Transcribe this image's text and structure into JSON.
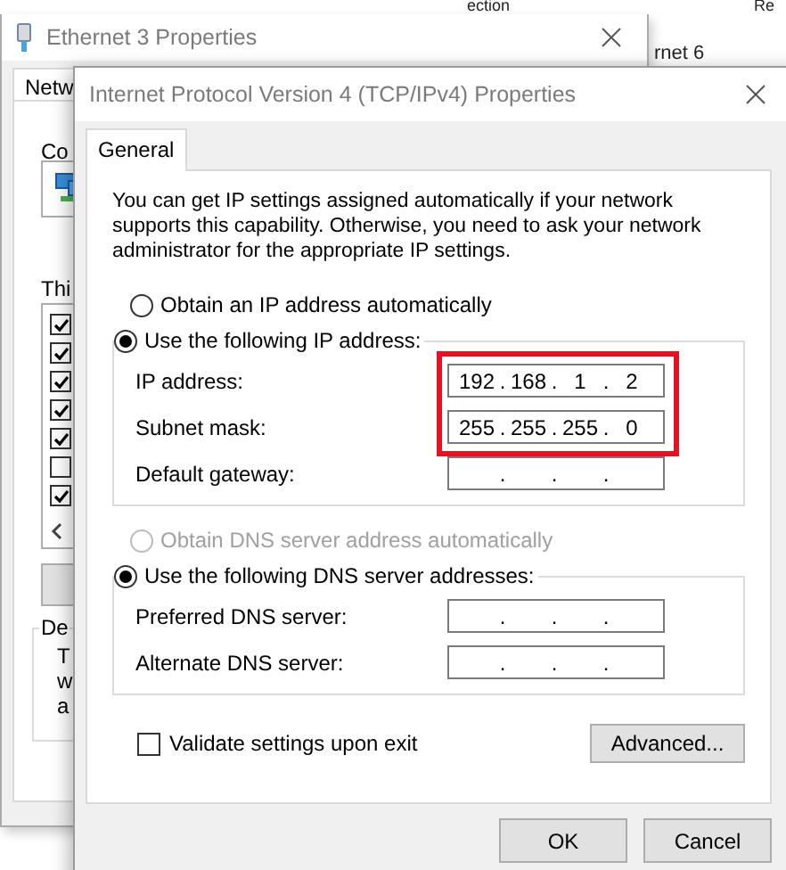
{
  "back_window": {
    "column_headers": [
      "ection",
      "Re"
    ],
    "item": "rnet 6"
  },
  "ethernet_dialog": {
    "title": "Ethernet 3 Properties",
    "tab": "Netw",
    "connect_label": "Co",
    "list_label": "Thi",
    "components": [
      {
        "checked": true
      },
      {
        "checked": true
      },
      {
        "checked": true
      },
      {
        "checked": true
      },
      {
        "checked": true
      },
      {
        "checked": false
      },
      {
        "checked": true
      }
    ],
    "description_group": "De",
    "description_lines": [
      "T",
      "w",
      "a"
    ]
  },
  "ipv4_dialog": {
    "title": "Internet Protocol Version 4 (TCP/IPv4) Properties",
    "tabs": [
      {
        "label": "General",
        "selected": true
      }
    ],
    "intro": "You can get IP settings assigned automatically if your network supports this capability. Otherwise, you need to ask your network administrator for the appropriate IP settings.",
    "separator": ".",
    "ip_auto": {
      "label": "Obtain an IP address automatically",
      "selected": false,
      "disabled": false
    },
    "ip_manual": {
      "label": "Use the following IP address:",
      "selected": true,
      "disabled": false
    },
    "ip_fields": [
      {
        "label": "IP address:",
        "octets": [
          "192",
          "168",
          "1",
          "2"
        ],
        "highlighted": true
      },
      {
        "label": "Subnet mask:",
        "octets": [
          "255",
          "255",
          "255",
          "0"
        ],
        "highlighted": true
      },
      {
        "label": "Default gateway:",
        "highlighted": false
      }
    ],
    "dns_auto": {
      "label": "Obtain DNS server address automatically",
      "selected": false,
      "disabled": true
    },
    "dns_manual": {
      "label": "Use the following DNS server addresses:",
      "selected": true,
      "disabled": false
    },
    "dns_fields": [
      {
        "label": "Preferred DNS server:",
        "highlighted": false
      },
      {
        "label": "Alternate DNS server:",
        "highlighted": false
      }
    ],
    "validate": {
      "label": "Validate settings upon exit",
      "checked": false
    },
    "advanced_button": "Advanced...",
    "buttons": [
      "OK",
      "Cancel"
    ]
  }
}
